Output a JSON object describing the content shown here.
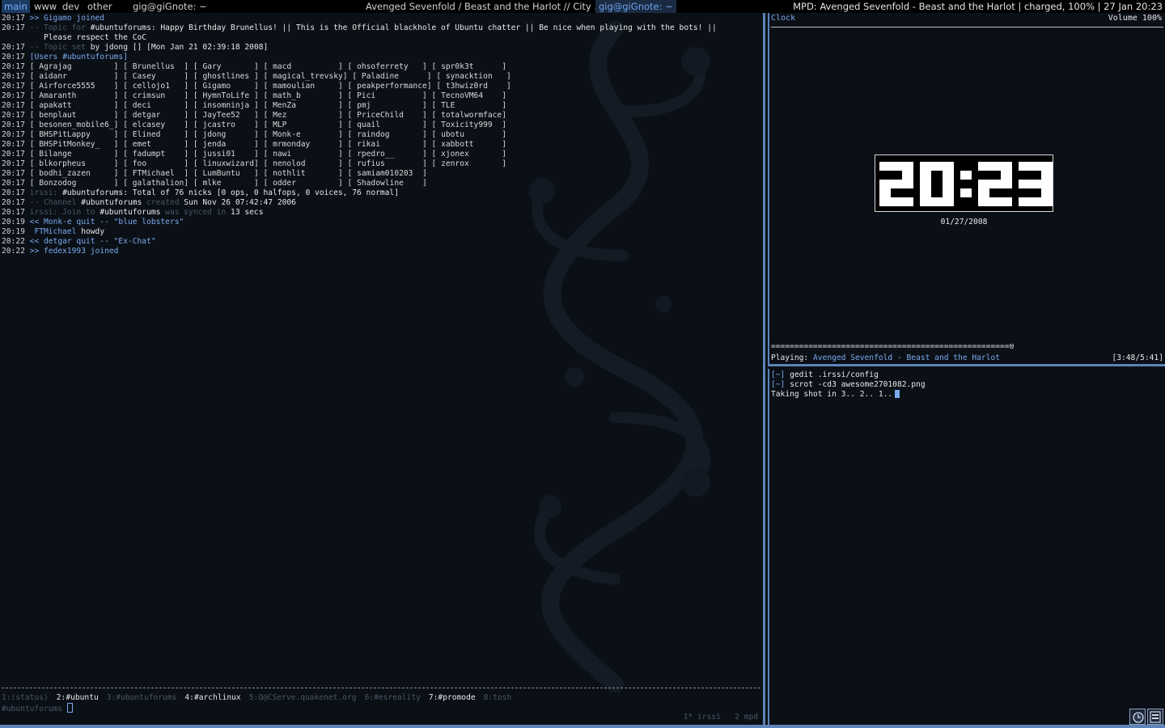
{
  "topbar": {
    "tags": [
      "main",
      "www",
      "dev",
      "other"
    ],
    "active_tag": "main",
    "windows": [
      "gig@giGnote: ~",
      "Avenged Sevenfold / Beast and the Harlot // City ...",
      "gig@giGnote: ~"
    ],
    "status": "MPD: Avenged Sevenfold - Beast and the Harlot | charged, 100% | 27 Jan 20:23"
  },
  "irssi": {
    "join1": {
      "ts": "20:17",
      "text": ">> Gigamo joined"
    },
    "topic": {
      "ts": "20:17",
      "pre": "-- Topic for ",
      "chan": "#ubuntuforums",
      "text": ": Happy Birthday Brunellus! || This is the Official blackhole of Ubuntu chatter || Be nice when playing with the bots! ||",
      "cont": "   Please respect the CoC"
    },
    "topicset": {
      "ts": "20:17",
      "pre": "-- Topic set ",
      "by": "by",
      "who": "jdong",
      "when": "[] [Mon Jan 21 02:39:18 2008]"
    },
    "users_header": {
      "ts": "20:17",
      "text": "[Users #ubuntuforums]"
    },
    "users": [
      [
        "Agrajag",
        "Brunellus",
        "Gary",
        "macd",
        "ohsoferrety",
        "spr0k3t"
      ],
      [
        "aidanr",
        "Casey",
        "ghostlines",
        "magical_trevsky",
        "Paladine",
        "synacktion"
      ],
      [
        "Airforce5555",
        "cellojo1",
        "Gigamo",
        "mamoulian",
        "peakperformance",
        "t3hwiz0rd"
      ],
      [
        "Amaranth",
        "crimsun",
        "HymnToLife",
        "math_b",
        "Pici",
        "TecnoVM64"
      ],
      [
        "apakatt",
        "deci",
        "insomninja",
        "MenZa",
        "pmj",
        "TLE"
      ],
      [
        "benplaut",
        "detgar",
        "JayTee52",
        "Mez",
        "PriceChild",
        "totalwormface"
      ],
      [
        "besonen_mobile6_",
        "elcasey",
        "jcastro",
        "MLP",
        "quail",
        "Toxicity999"
      ],
      [
        "BHSPitLappy",
        "Elined",
        "jdong",
        "Monk-e",
        "raindog",
        "ubotu"
      ],
      [
        "BHSPitMonkey_",
        "emet",
        "jenda",
        "mrmonday",
        "rikai",
        "xabbott"
      ],
      [
        "Bilange",
        "fadumpt",
        "jussi01",
        "nawi",
        "rpedro__",
        "xjonex"
      ],
      [
        "blkorpheus",
        "foo",
        "linuxwizard",
        "nenolod",
        "rufius",
        "zenrox"
      ],
      [
        "bodhi_zazen",
        "FTMichael",
        "LumBuntu",
        "nothlit",
        "samiam010203",
        ""
      ],
      [
        "Bonzodog",
        "galathalion",
        "mlke",
        "odder",
        "Shadowline",
        ""
      ]
    ],
    "total": {
      "ts": "20:17",
      "pre": "irssi: ",
      "text": "#ubuntuforums: Total of 76 nicks [0 ops, 0 halfops, 0 voices, 76 normal]"
    },
    "created": {
      "ts": "20:17",
      "pre": "-- Channel ",
      "chan": "#ubuntuforums",
      "mid": " created ",
      "when": "Sun Nov 26 07:42:47 2006"
    },
    "synced": {
      "ts": "20:17",
      "pre": "irssi: Join to ",
      "chan": "#ubuntuforums",
      "mid": " was synced in ",
      "dur": "13 secs"
    },
    "quit1": {
      "ts": "20:19",
      "text": "<< Monk-e quit -- \"blue lobsters\""
    },
    "msg": {
      "ts": "20:19",
      "nick": " FTMichael",
      "text": " howdy"
    },
    "quit2": {
      "ts": "20:22",
      "text": "<< detgar quit -- \"Ex-Chat\""
    },
    "join2": {
      "ts": "20:22",
      "text": ">> fedex1993 joined"
    },
    "act": [
      {
        "label": "1:(status)",
        "hl": false
      },
      {
        "label": "2:#ubuntu",
        "hl": true
      },
      {
        "label": "3:#ubuntuforums",
        "hl": false
      },
      {
        "label": "4:#archlinux",
        "hl": true
      },
      {
        "label": "5:Q@CServe.quakenet.org",
        "hl": false
      },
      {
        "label": "6:#esreality",
        "hl": false
      },
      {
        "label": "7:#promode",
        "hl": true
      },
      {
        "label": "8:tosh",
        "hl": false
      }
    ],
    "prompt": "#ubuntuforums",
    "winbar": "1* irssi   2 mpd"
  },
  "clock": {
    "title": "Clock",
    "volume": "Volume 100%",
    "time": "20:23",
    "date": "01/27/2008",
    "progress_bar": "===================================================0",
    "progress_fraction": 0.7,
    "playing_label": "Playing:",
    "track": "Avenged Sevenfold - Beast and the Harlot",
    "time_pos": "[3:48/5:41]"
  },
  "terminal": {
    "lines": [
      {
        "prompt": "[~]",
        "cmd": " gedit .irssi/config"
      },
      {
        "prompt": "[~]",
        "cmd": " scrot -cd3 awesome2701082.png"
      },
      {
        "prompt": "",
        "cmd": "Taking shot in 3.. 2.. 1.."
      }
    ]
  },
  "colors": {
    "accent": "#5c84b8",
    "nick_blue": "#7aa9ec",
    "dim": "#4a5564"
  }
}
